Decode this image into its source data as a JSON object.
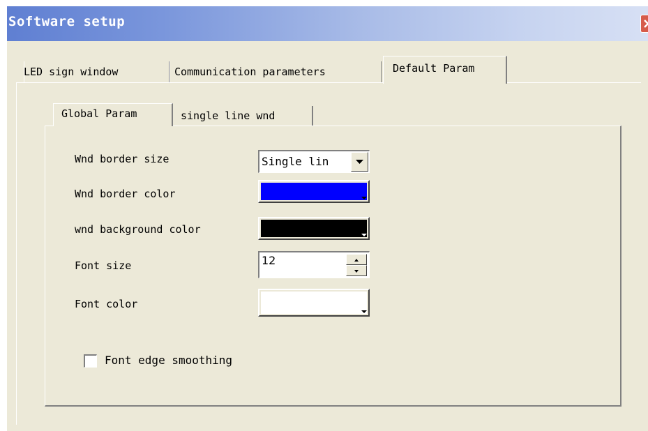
{
  "window": {
    "title": "Software setup"
  },
  "tabs": {
    "outer": [
      {
        "label": "LED sign window",
        "active": false
      },
      {
        "label": "Communication parameters",
        "active": false
      },
      {
        "label": "Default Param",
        "active": true
      }
    ],
    "inner": [
      {
        "label": "Global Param",
        "active": true
      },
      {
        "label": "single line wnd",
        "active": false
      }
    ]
  },
  "fields": {
    "border_size": {
      "label": "Wnd border size",
      "value": "Single lin"
    },
    "border_color": {
      "label": "Wnd border color",
      "color": "#0000ff"
    },
    "background_color": {
      "label": "wnd background color",
      "color": "#000000"
    },
    "font_size": {
      "label": "Font size",
      "value": "12"
    },
    "font_color": {
      "label": "Font color",
      "color": "#ffffff"
    }
  },
  "checkbox": {
    "label": "Font edge smoothing",
    "checked": false
  },
  "colors": {
    "dialog_bg": "#ece9d8",
    "title_start": "#5f7fd2",
    "title_end": "#d7e0f4",
    "close_button": "#d65b4a"
  },
  "icons": {
    "close": "close-icon",
    "dropdown": "chevron-down-icon",
    "spin_up": "spin-up-icon",
    "spin_down": "spin-down-icon"
  }
}
